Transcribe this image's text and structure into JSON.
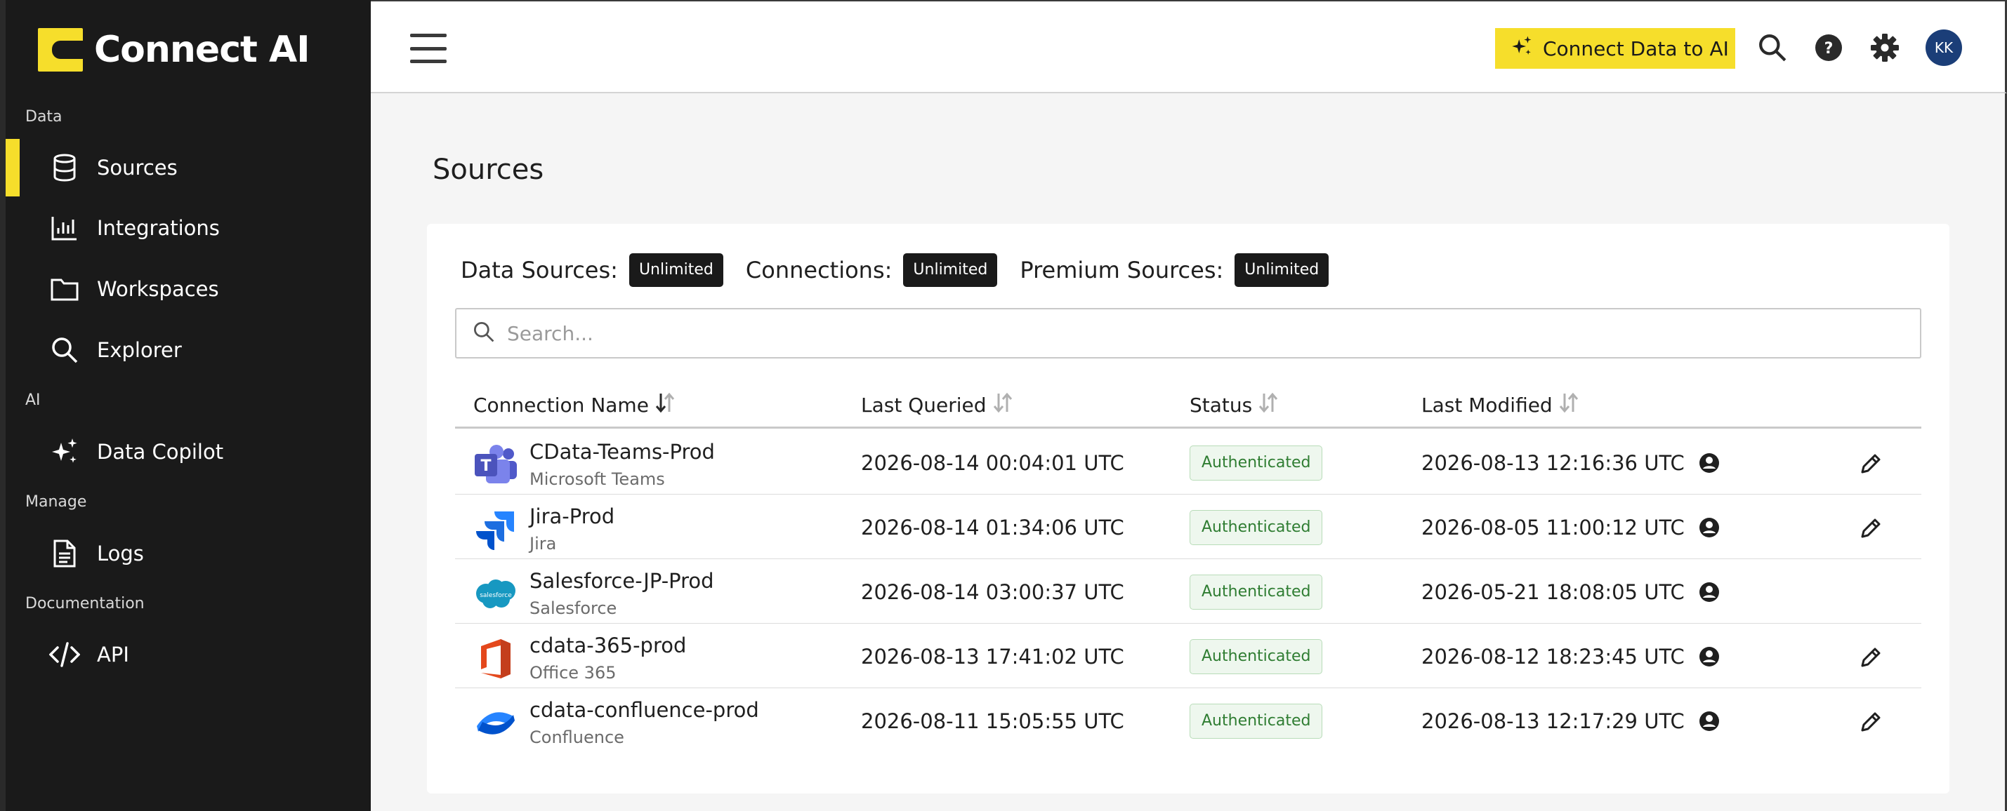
{
  "brand": {
    "name": "Connect AI"
  },
  "sidebar": {
    "sections": [
      {
        "label": "Data"
      },
      {
        "label": "AI"
      },
      {
        "label": "Manage"
      },
      {
        "label": "Documentation"
      }
    ],
    "items": [
      {
        "label": "Sources",
        "icon": "database-icon",
        "active": true
      },
      {
        "label": "Integrations",
        "icon": "bar-chart-icon"
      },
      {
        "label": "Workspaces",
        "icon": "folder-icon"
      },
      {
        "label": "Explorer",
        "icon": "search-icon"
      },
      {
        "label": "Data Copilot",
        "icon": "sparkles-icon"
      },
      {
        "label": "Logs",
        "icon": "document-icon"
      },
      {
        "label": "API",
        "icon": "code-icon"
      }
    ]
  },
  "header": {
    "connect_button_label": "Connect Data to AI",
    "avatar_initials": "KK",
    "accent_color": "#f6de2b"
  },
  "page": {
    "title": "Sources",
    "quotas": [
      {
        "label": "Data Sources:",
        "value": "Unlimited"
      },
      {
        "label": "Connections:",
        "value": "Unlimited"
      },
      {
        "label": "Premium Sources:",
        "value": "Unlimited"
      }
    ],
    "search_placeholder": "Search...",
    "columns": [
      "Connection Name",
      "Last Queried",
      "Status",
      "Last Modified"
    ],
    "rows": [
      {
        "name": "CData-Teams-Prod",
        "source": "Microsoft Teams",
        "logo": "teams-logo",
        "last_queried": "2026-08-14 00:04:01 UTC",
        "status": "Authenticated",
        "last_modified": "2026-08-13 12:16:36 UTC",
        "editable": true
      },
      {
        "name": "Jira-Prod",
        "source": "Jira",
        "logo": "jira-logo",
        "last_queried": "2026-08-14 01:34:06 UTC",
        "status": "Authenticated",
        "last_modified": "2026-08-05 11:00:12 UTC",
        "editable": true
      },
      {
        "name": "Salesforce-JP-Prod",
        "source": "Salesforce",
        "logo": "salesforce-logo",
        "last_queried": "2026-08-14 03:00:37 UTC",
        "status": "Authenticated",
        "last_modified": "2026-05-21 18:08:05 UTC",
        "editable": false
      },
      {
        "name": "cdata-365-prod",
        "source": "Office 365",
        "logo": "office365-logo",
        "last_queried": "2026-08-13 17:41:02 UTC",
        "status": "Authenticated",
        "last_modified": "2026-08-12 18:23:45 UTC",
        "editable": true
      },
      {
        "name": "cdata-confluence-prod",
        "source": "Confluence",
        "logo": "confluence-logo",
        "last_queried": "2026-08-11 15:05:55 UTC",
        "status": "Authenticated",
        "last_modified": "2026-08-13 12:17:29 UTC",
        "editable": true
      }
    ]
  }
}
